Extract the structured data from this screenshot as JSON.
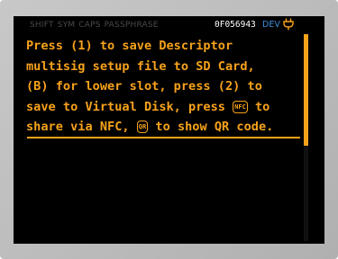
{
  "status_bar": {
    "modes": [
      "SHIFT",
      "SYM",
      "CAPS",
      "PASSPHRASE"
    ],
    "fingerprint": "0F056943",
    "network": "DEV",
    "power_icon": "plug-icon"
  },
  "message": {
    "line1": "Press (1) to save Descriptor",
    "line2": "multisig setup file to SD Card,",
    "line3": "(B) for lower slot, press (2) to",
    "line4_pre": "save to Virtual Disk, press ",
    "nfc_badge": "NFC",
    "line4_post": " to",
    "line5_pre": "share via NFC, ",
    "qr_badge": "QR",
    "line5_post": " to show QR code."
  },
  "colors": {
    "accent": "#f7a21b",
    "network": "#3f8fd8",
    "screen_bg": "#000000",
    "bezel": "#bcbcbc"
  }
}
